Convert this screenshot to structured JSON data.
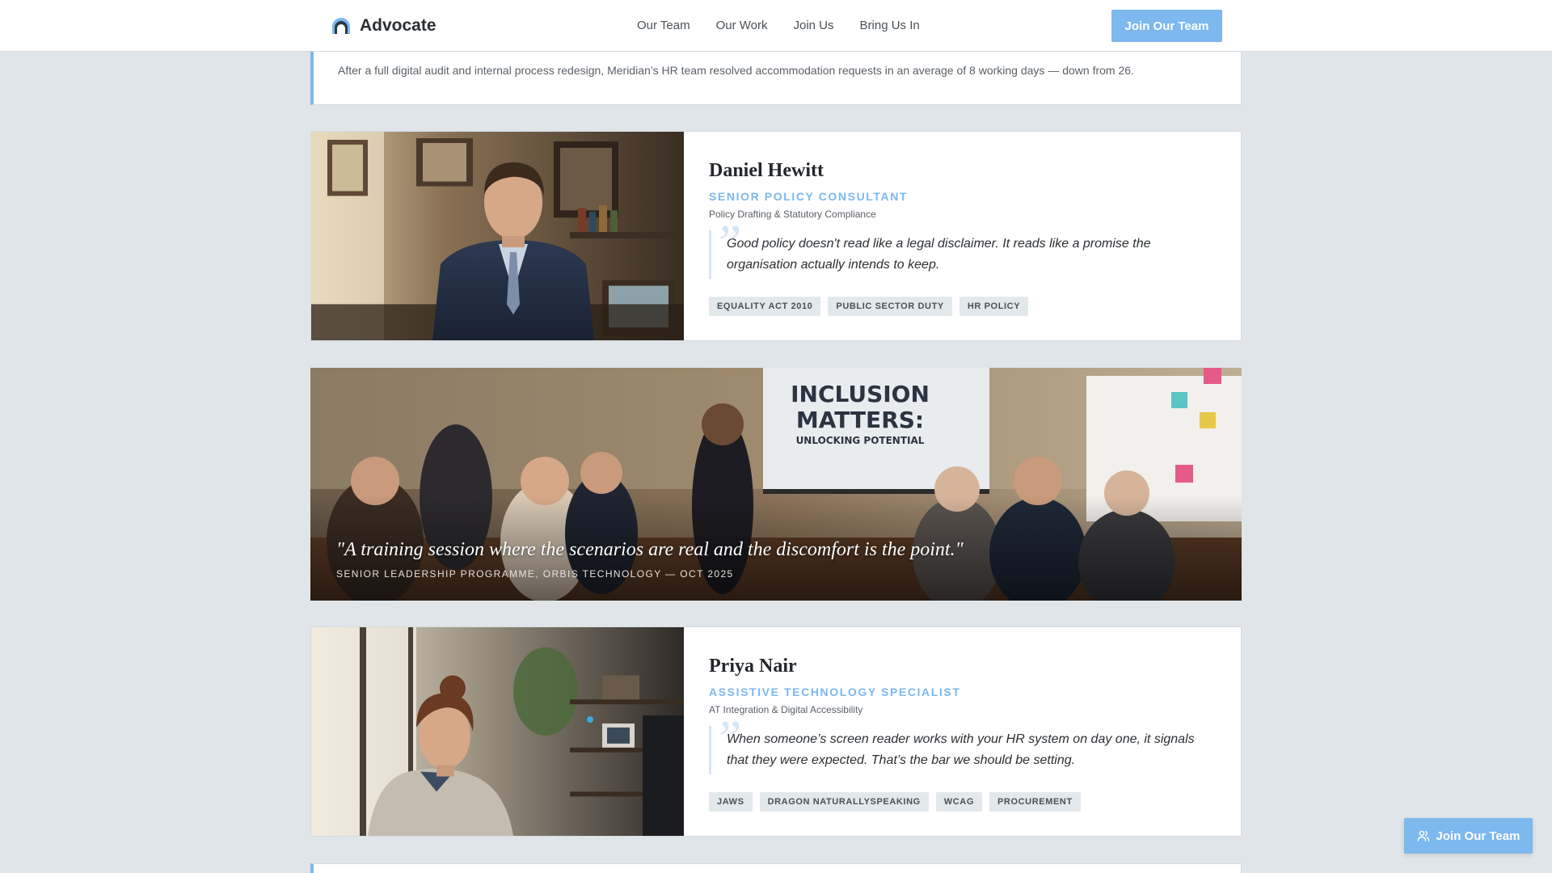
{
  "header": {
    "brand": "Advocate",
    "nav": [
      "Our Team",
      "Our Work",
      "Join Us",
      "Bring Us In"
    ],
    "cta_label": "Join Our Team"
  },
  "case_strip": {
    "text": "After a full digital audit and internal process redesign, Meridian’s HR team resolved accommodation requests in an average of 8 working days — down from 26."
  },
  "profiles": [
    {
      "name": "Daniel Hewitt",
      "role": "SENIOR POLICY CONSULTANT",
      "specialty": "Policy Drafting & Statutory Compliance",
      "quote": "Good policy doesn't read like a legal disclaimer. It reads like a promise the organisation actually intends to keep.",
      "tags": [
        "EQUALITY ACT 2010",
        "PUBLIC SECTOR DUTY",
        "HR POLICY"
      ]
    },
    {
      "name": "Priya Nair",
      "role": "ASSISTIVE TECHNOLOGY SPECIALIST",
      "specialty": "AT Integration & Digital Accessibility",
      "quote": "When someone’s screen reader works with your HR system on day one, it signals that they were expected. That’s the bar we should be setting.",
      "tags": [
        "JAWS",
        "DRAGON NATURALLYSPEAKING",
        "WCAG",
        "PROCUREMENT"
      ]
    }
  ],
  "banner": {
    "screen_title_line1": "INCLUSION",
    "screen_title_line2": "MATTERS:",
    "screen_subtitle": "UNLOCKING POTENTIAL",
    "quote": "\"A training session where the scenarios are real and the discomfort is the point.\"",
    "caption": "SENIOR LEADERSHIP PROGRAMME, ORBIS TECHNOLOGY — OCT 2025"
  },
  "floating_cta": {
    "label": "Join Our Team"
  },
  "icons": {
    "brand": "arch-logo-icon",
    "floating_cta": "users-icon",
    "quote": "quote-mark-icon"
  },
  "colors": {
    "accent": "#7db8ee",
    "page_background": "#dfe5e8",
    "card_background": "#ffffff",
    "tag_background": "#e3e8eb"
  }
}
